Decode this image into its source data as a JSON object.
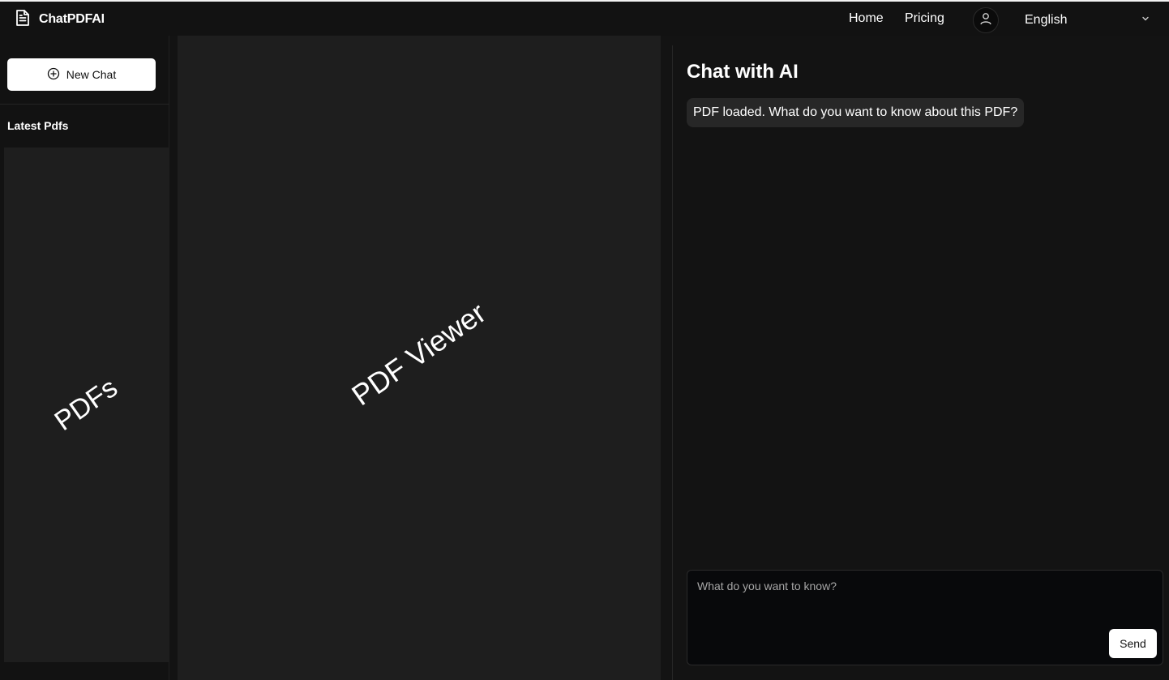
{
  "header": {
    "brand": "ChatPDFAI",
    "brand_icon": "document-icon",
    "nav": [
      {
        "label": "Home"
      },
      {
        "label": "Pricing"
      }
    ],
    "avatar_icon": "user-icon",
    "language": {
      "selected": "English",
      "icon": "chevron-down-icon"
    }
  },
  "sidebar": {
    "new_chat_label": "New Chat",
    "new_chat_icon": "plus-circle-icon",
    "section_title": "Latest Pdfs",
    "list_placeholder": "PDFs"
  },
  "viewer": {
    "placeholder": "PDF Viewer"
  },
  "chat": {
    "title": "Chat with AI",
    "messages": [
      {
        "role": "assistant",
        "text": "PDF loaded. What do you want to know about this PDF?"
      }
    ],
    "input": {
      "value": "",
      "placeholder": "What do you want to know?"
    },
    "send_label": "Send"
  },
  "colors": {
    "background": "#131313",
    "panel": "#1e1e1e",
    "message_bubble": "#272727",
    "button": "#ffffff"
  }
}
